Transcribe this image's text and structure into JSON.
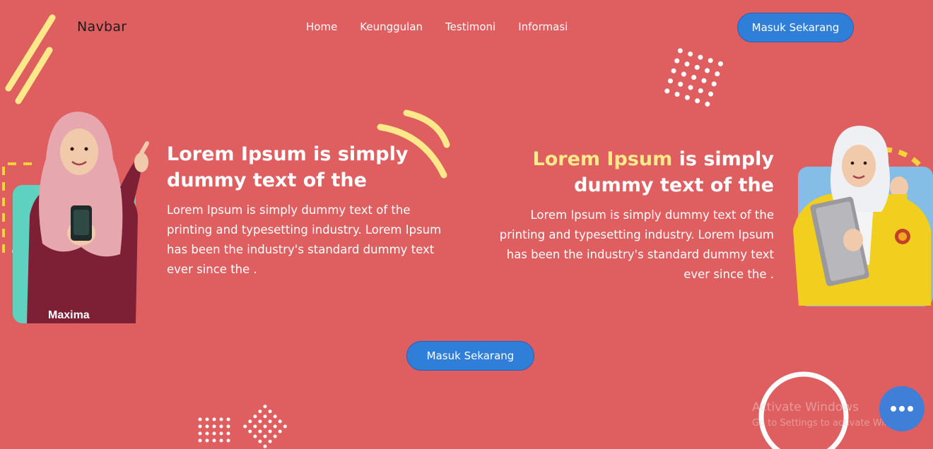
{
  "navbar": {
    "brand": "Navbar",
    "links": [
      "Home",
      "Keunggulan",
      "Testimoni",
      "Informasi"
    ],
    "cta_label": "Masuk Sekarang"
  },
  "hero_left": {
    "title": "Lorem Ipsum is simply dummy text of the",
    "description": "Lorem Ipsum is simply dummy text of the printing and typesetting industry. Lorem Ipsum has been the industry's standard dummy text ever since the ."
  },
  "hero_right": {
    "title_highlight": "Lorem Ipsum",
    "title_rest": " is simply dummy text of the",
    "description": "Lorem Ipsum is simply dummy text of the printing and typesetting industry. Lorem Ipsum has been the industry's standard dummy text ever since the ."
  },
  "person_left": {
    "shirt_logo": "Maxima"
  },
  "main_cta": {
    "label": "Masuk Sekarang"
  },
  "os_watermark": {
    "title": "Activate Windows",
    "subtitle": "Go to Settings to activate Windows."
  },
  "colors": {
    "background": "#df5f60",
    "button": "#2f7fd8",
    "highlight": "#fde98a",
    "accent_yellow": "#fde98a",
    "left_card": "#5fd1c0",
    "right_card": "#84bde6"
  },
  "icons": {
    "chat": "chat-bubble-dots-icon"
  }
}
